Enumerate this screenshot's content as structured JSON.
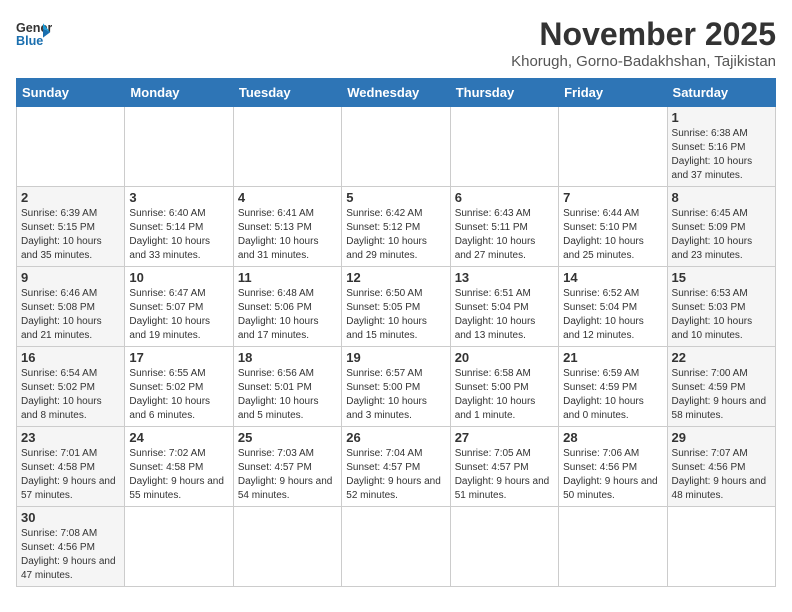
{
  "header": {
    "logo_line1": "General",
    "logo_line2": "Blue",
    "month": "November 2025",
    "location": "Khorugh, Gorno-Badakhshan, Tajikistan"
  },
  "weekdays": [
    "Sunday",
    "Monday",
    "Tuesday",
    "Wednesday",
    "Thursday",
    "Friday",
    "Saturday"
  ],
  "weeks": [
    [
      {
        "day": "",
        "info": ""
      },
      {
        "day": "",
        "info": ""
      },
      {
        "day": "",
        "info": ""
      },
      {
        "day": "",
        "info": ""
      },
      {
        "day": "",
        "info": ""
      },
      {
        "day": "",
        "info": ""
      },
      {
        "day": "1",
        "info": "Sunrise: 6:38 AM\nSunset: 5:16 PM\nDaylight: 10 hours and 37 minutes."
      }
    ],
    [
      {
        "day": "2",
        "info": "Sunrise: 6:39 AM\nSunset: 5:15 PM\nDaylight: 10 hours and 35 minutes."
      },
      {
        "day": "3",
        "info": "Sunrise: 6:40 AM\nSunset: 5:14 PM\nDaylight: 10 hours and 33 minutes."
      },
      {
        "day": "4",
        "info": "Sunrise: 6:41 AM\nSunset: 5:13 PM\nDaylight: 10 hours and 31 minutes."
      },
      {
        "day": "5",
        "info": "Sunrise: 6:42 AM\nSunset: 5:12 PM\nDaylight: 10 hours and 29 minutes."
      },
      {
        "day": "6",
        "info": "Sunrise: 6:43 AM\nSunset: 5:11 PM\nDaylight: 10 hours and 27 minutes."
      },
      {
        "day": "7",
        "info": "Sunrise: 6:44 AM\nSunset: 5:10 PM\nDaylight: 10 hours and 25 minutes."
      },
      {
        "day": "8",
        "info": "Sunrise: 6:45 AM\nSunset: 5:09 PM\nDaylight: 10 hours and 23 minutes."
      }
    ],
    [
      {
        "day": "9",
        "info": "Sunrise: 6:46 AM\nSunset: 5:08 PM\nDaylight: 10 hours and 21 minutes."
      },
      {
        "day": "10",
        "info": "Sunrise: 6:47 AM\nSunset: 5:07 PM\nDaylight: 10 hours and 19 minutes."
      },
      {
        "day": "11",
        "info": "Sunrise: 6:48 AM\nSunset: 5:06 PM\nDaylight: 10 hours and 17 minutes."
      },
      {
        "day": "12",
        "info": "Sunrise: 6:50 AM\nSunset: 5:05 PM\nDaylight: 10 hours and 15 minutes."
      },
      {
        "day": "13",
        "info": "Sunrise: 6:51 AM\nSunset: 5:04 PM\nDaylight: 10 hours and 13 minutes."
      },
      {
        "day": "14",
        "info": "Sunrise: 6:52 AM\nSunset: 5:04 PM\nDaylight: 10 hours and 12 minutes."
      },
      {
        "day": "15",
        "info": "Sunrise: 6:53 AM\nSunset: 5:03 PM\nDaylight: 10 hours and 10 minutes."
      }
    ],
    [
      {
        "day": "16",
        "info": "Sunrise: 6:54 AM\nSunset: 5:02 PM\nDaylight: 10 hours and 8 minutes."
      },
      {
        "day": "17",
        "info": "Sunrise: 6:55 AM\nSunset: 5:02 PM\nDaylight: 10 hours and 6 minutes."
      },
      {
        "day": "18",
        "info": "Sunrise: 6:56 AM\nSunset: 5:01 PM\nDaylight: 10 hours and 5 minutes."
      },
      {
        "day": "19",
        "info": "Sunrise: 6:57 AM\nSunset: 5:00 PM\nDaylight: 10 hours and 3 minutes."
      },
      {
        "day": "20",
        "info": "Sunrise: 6:58 AM\nSunset: 5:00 PM\nDaylight: 10 hours and 1 minute."
      },
      {
        "day": "21",
        "info": "Sunrise: 6:59 AM\nSunset: 4:59 PM\nDaylight: 10 hours and 0 minutes."
      },
      {
        "day": "22",
        "info": "Sunrise: 7:00 AM\nSunset: 4:59 PM\nDaylight: 9 hours and 58 minutes."
      }
    ],
    [
      {
        "day": "23",
        "info": "Sunrise: 7:01 AM\nSunset: 4:58 PM\nDaylight: 9 hours and 57 minutes."
      },
      {
        "day": "24",
        "info": "Sunrise: 7:02 AM\nSunset: 4:58 PM\nDaylight: 9 hours and 55 minutes."
      },
      {
        "day": "25",
        "info": "Sunrise: 7:03 AM\nSunset: 4:57 PM\nDaylight: 9 hours and 54 minutes."
      },
      {
        "day": "26",
        "info": "Sunrise: 7:04 AM\nSunset: 4:57 PM\nDaylight: 9 hours and 52 minutes."
      },
      {
        "day": "27",
        "info": "Sunrise: 7:05 AM\nSunset: 4:57 PM\nDaylight: 9 hours and 51 minutes."
      },
      {
        "day": "28",
        "info": "Sunrise: 7:06 AM\nSunset: 4:56 PM\nDaylight: 9 hours and 50 minutes."
      },
      {
        "day": "29",
        "info": "Sunrise: 7:07 AM\nSunset: 4:56 PM\nDaylight: 9 hours and 48 minutes."
      }
    ],
    [
      {
        "day": "30",
        "info": "Sunrise: 7:08 AM\nSunset: 4:56 PM\nDaylight: 9 hours and 47 minutes."
      },
      {
        "day": "",
        "info": ""
      },
      {
        "day": "",
        "info": ""
      },
      {
        "day": "",
        "info": ""
      },
      {
        "day": "",
        "info": ""
      },
      {
        "day": "",
        "info": ""
      },
      {
        "day": "",
        "info": ""
      }
    ]
  ]
}
